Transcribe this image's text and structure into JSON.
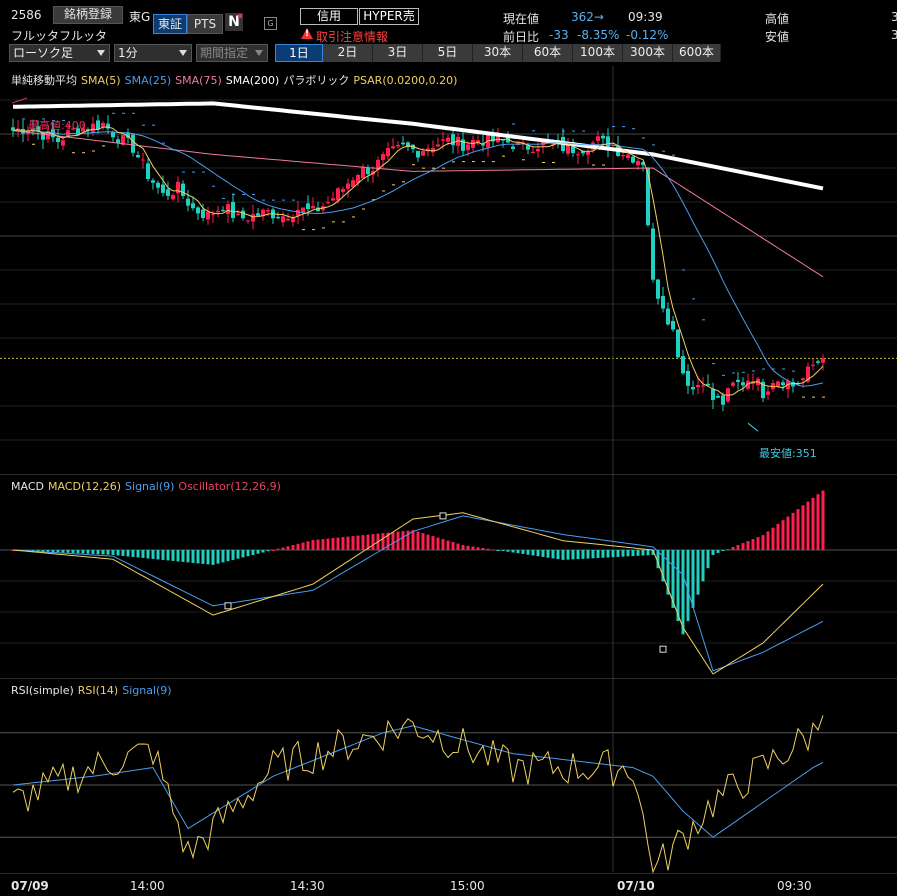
{
  "header": {
    "code": "2586",
    "register_button": "銘柄登録",
    "market": "東G",
    "exchange_tabs": [
      "東証",
      "PTS"
    ],
    "n_icon_label": "N",
    "g_icon_label": "G",
    "name": "フルッタフルッタ",
    "credit_button": "信用",
    "hyper_button": "HYPER売",
    "warning": "取引注意情報",
    "current_label": "現在値",
    "current_value": "362→",
    "time": "09:39",
    "prev_label": "前日比",
    "change": "-33",
    "change_pct": "-8.35%",
    "change_pct2": "-0.12%",
    "high_label": "高値",
    "low_label": "安値",
    "high_value_partial": "3",
    "low_value_partial": "3"
  },
  "controls": {
    "chart_type": "ローソク足",
    "interval": "1分",
    "period": "期間指定",
    "timeframes": [
      "1日",
      "2日",
      "3日",
      "5日",
      "30本",
      "60本",
      "100本",
      "300本",
      "600本"
    ],
    "active_timeframe": 0
  },
  "legends": {
    "main": [
      {
        "text": "単純移動平均",
        "color": "#e6e6e6"
      },
      {
        "text": "SMA(5)",
        "color": "#f0d060"
      },
      {
        "text": "SMA(25)",
        "color": "#4a9cf0"
      },
      {
        "text": "SMA(75)",
        "color": "#f07aa0"
      },
      {
        "text": "SMA(200)",
        "color": "#ffffff"
      },
      {
        "text": "パラボリック",
        "color": "#e6e6e6"
      },
      {
        "text": "PSAR(0.0200,0.20)",
        "color": "#f0d060"
      }
    ],
    "macd": [
      {
        "text": "MACD",
        "color": "#e6e6e6"
      },
      {
        "text": "MACD(12,26)",
        "color": "#f0d060"
      },
      {
        "text": "Signal(9)",
        "color": "#4a9cf0"
      },
      {
        "text": "Oscillator(12,26,9)",
        "color": "#f04060"
      }
    ],
    "rsi": [
      {
        "text": "RSI(simple)",
        "color": "#e6e6e6"
      },
      {
        "text": "RSI(14)",
        "color": "#f0d060"
      },
      {
        "text": "Signal(9)",
        "color": "#4a9cf0"
      }
    ]
  },
  "annotations": {
    "high": "最高値:400",
    "low": "最安値:351"
  },
  "x_axis": {
    "labels": [
      "07/09",
      "14:00",
      "14:30",
      "15:00",
      "07/10",
      "09:30"
    ],
    "bold": [
      true,
      false,
      false,
      false,
      true,
      false
    ]
  },
  "colors": {
    "up": "#ff2050",
    "down": "#20d0c0",
    "sma5": "#f0d060",
    "sma25": "#4a9cf0",
    "sma75": "#f07aa0",
    "sma200": "#ffffff",
    "psar": "#f0d060",
    "hist_pos": "#ff2050",
    "hist_neg": "#20d0c0"
  },
  "chart_data": [
    {
      "type": "candlestick",
      "title": "",
      "ylim": [
        345,
        405
      ],
      "series_names": [
        "SMA(5)",
        "SMA(25)",
        "SMA(75)",
        "SMA(200)",
        "PSAR(0.0200,0.20)"
      ],
      "high": 400,
      "low": 351,
      "last": 362,
      "close_profile": [
        [
          0,
          395.5
        ],
        [
          3,
          396
        ],
        [
          6,
          395
        ],
        [
          9,
          394
        ],
        [
          12,
          395.5
        ],
        [
          15,
          396
        ],
        [
          18,
          396.5
        ],
        [
          21,
          394.5
        ],
        [
          24,
          393
        ],
        [
          27,
          389
        ],
        [
          30,
          386
        ],
        [
          33,
          387
        ],
        [
          36,
          384
        ],
        [
          39,
          383
        ],
        [
          42,
          384.5
        ],
        [
          45,
          382.5
        ],
        [
          48,
          383
        ],
        [
          51,
          383.5
        ],
        [
          54,
          383
        ],
        [
          57,
          384
        ],
        [
          60,
          383.5
        ],
        [
          63,
          385
        ],
        [
          66,
          387
        ],
        [
          69,
          389.5
        ],
        [
          72,
          390
        ],
        [
          75,
          392
        ],
        [
          78,
          393
        ],
        [
          81,
          392.5
        ],
        [
          84,
          393.5
        ],
        [
          87,
          394
        ],
        [
          90,
          393.5
        ],
        [
          93,
          394.2
        ],
        [
          96,
          394
        ],
        [
          99,
          393.8
        ],
        [
          102,
          393
        ],
        [
          105,
          393.5
        ],
        [
          108,
          393.5
        ],
        [
          111,
          392.8
        ],
        [
          114,
          393
        ],
        [
          117,
          394
        ],
        [
          120,
          393
        ],
        [
          123,
          392
        ],
        [
          126,
          391
        ],
        [
          128,
          373
        ],
        [
          130,
          370
        ],
        [
          132,
          366
        ],
        [
          134,
          360
        ],
        [
          136,
          357.5
        ],
        [
          138,
          359
        ],
        [
          140,
          356
        ],
        [
          142,
          355.5
        ],
        [
          144,
          358
        ],
        [
          146,
          358.5
        ],
        [
          148,
          359.5
        ],
        [
          150,
          357
        ],
        [
          152,
          359
        ],
        [
          154,
          359
        ],
        [
          156,
          358
        ],
        [
          158,
          359
        ],
        [
          160,
          361
        ],
        [
          162,
          362
        ]
      ],
      "sma200_profile": [
        [
          0,
          399
        ],
        [
          40,
          399.5
        ],
        [
          80,
          396.5
        ],
        [
          128,
          392
        ],
        [
          162,
          387
        ]
      ],
      "sma75_profile": [
        [
          0,
          395.5
        ],
        [
          40,
          392
        ],
        [
          80,
          389.5
        ],
        [
          128,
          390
        ],
        [
          162,
          374
        ]
      ]
    },
    {
      "type": "line",
      "title": "",
      "ylim": [
        -4,
        2
      ],
      "series_names": [
        "MACD(12,26)",
        "Signal(9)",
        "Oscillator(12,26,9)"
      ],
      "macd_profile": [
        [
          0,
          0
        ],
        [
          20,
          -0.3
        ],
        [
          40,
          -2.1
        ],
        [
          60,
          -1.1
        ],
        [
          80,
          1
        ],
        [
          90,
          1.2
        ],
        [
          110,
          0.3
        ],
        [
          128,
          0
        ],
        [
          134,
          -2.5
        ],
        [
          140,
          -4
        ],
        [
          150,
          -3
        ],
        [
          162,
          -1.1
        ]
      ],
      "signal_profile": [
        [
          0,
          0
        ],
        [
          20,
          -0.2
        ],
        [
          40,
          -1.8
        ],
        [
          60,
          -1.3
        ],
        [
          80,
          0.6
        ],
        [
          90,
          1.1
        ],
        [
          110,
          0.5
        ],
        [
          128,
          0.1
        ],
        [
          134,
          -0.8
        ],
        [
          140,
          -3.9
        ],
        [
          150,
          -3.3
        ],
        [
          162,
          -2.3
        ]
      ]
    },
    {
      "type": "line",
      "title": "",
      "ylim": [
        0,
        100
      ],
      "series_names": [
        "RSI(14)",
        "Signal(9)"
      ],
      "rsi_profile": [
        [
          0,
          40
        ],
        [
          16,
          60
        ],
        [
          28,
          70
        ],
        [
          35,
          10
        ],
        [
          52,
          60
        ],
        [
          74,
          80
        ],
        [
          80,
          85
        ],
        [
          100,
          60
        ],
        [
          124,
          60
        ],
        [
          128,
          0
        ],
        [
          134,
          20
        ],
        [
          140,
          40
        ],
        [
          160,
          80
        ],
        [
          162,
          90
        ]
      ],
      "signal_profile": [
        [
          0,
          50
        ],
        [
          16,
          55
        ],
        [
          28,
          60
        ],
        [
          35,
          25
        ],
        [
          52,
          55
        ],
        [
          74,
          80
        ],
        [
          80,
          84
        ],
        [
          100,
          68
        ],
        [
          124,
          60
        ],
        [
          128,
          55
        ],
        [
          134,
          35
        ],
        [
          140,
          20
        ],
        [
          160,
          60
        ],
        [
          162,
          63
        ]
      ]
    }
  ]
}
